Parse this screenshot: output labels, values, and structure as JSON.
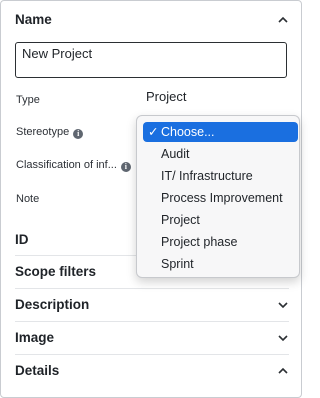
{
  "name_section": {
    "title": "Name",
    "value": "New Project"
  },
  "fields": [
    {
      "label": "Type",
      "value": "Project"
    },
    {
      "label": "Stereotype"
    },
    {
      "label": "Classification of inf..."
    },
    {
      "label": "Note"
    }
  ],
  "info_icon_glyph": "i",
  "dropdown": {
    "checkmark": "✓",
    "selected": "Choose...",
    "options": [
      "Choose...",
      "Audit",
      "IT/ Infrastructure",
      "Process Improvement",
      "Project",
      "Project phase",
      "Sprint"
    ]
  },
  "sections": [
    {
      "title": "ID",
      "state": "collapsed"
    },
    {
      "title": "Scope filters",
      "state": "collapsed"
    },
    {
      "title": "Description",
      "state": "collapsed"
    },
    {
      "title": "Image",
      "state": "collapsed"
    },
    {
      "title": "Details",
      "state": "expanded"
    }
  ],
  "colors": {
    "accent": "#1a6fe0",
    "border": "#c9ccd1"
  }
}
